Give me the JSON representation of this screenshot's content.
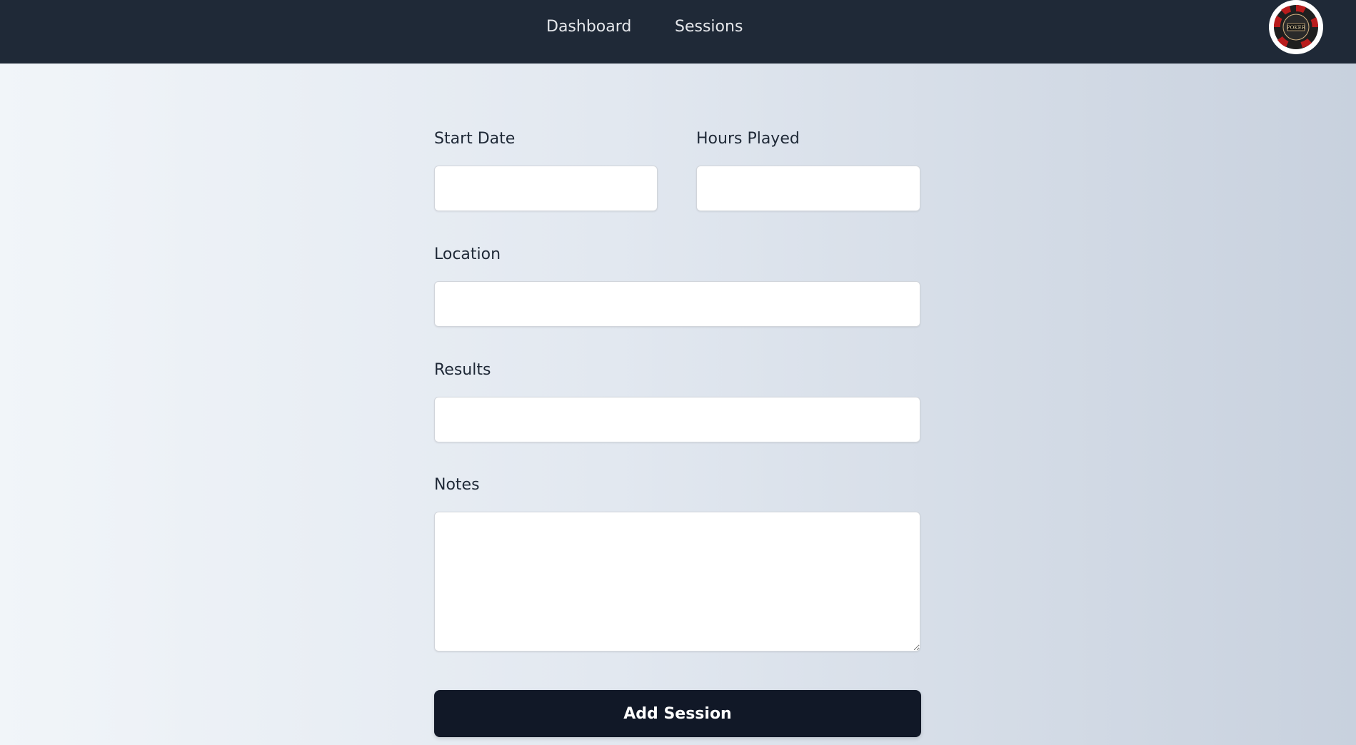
{
  "nav": {
    "links": [
      {
        "label": "Dashboard"
      },
      {
        "label": "Sessions"
      }
    ],
    "logo_icon": "poker-chip-icon",
    "logo_text": "POKER"
  },
  "form": {
    "start_date": {
      "label": "Start Date",
      "value": "",
      "placeholder": ""
    },
    "hours_played": {
      "label": "Hours Played",
      "value": "",
      "placeholder": ""
    },
    "location": {
      "label": "Location",
      "value": "",
      "placeholder": ""
    },
    "results": {
      "label": "Results",
      "value": "",
      "placeholder": ""
    },
    "notes": {
      "label": "Notes",
      "value": "",
      "placeholder": ""
    },
    "submit_label": "Add Session"
  },
  "colors": {
    "navbar": "#1f2937",
    "button": "#111827",
    "chip_red": "#b91c1c",
    "chip_dark": "#1f1f1f"
  }
}
